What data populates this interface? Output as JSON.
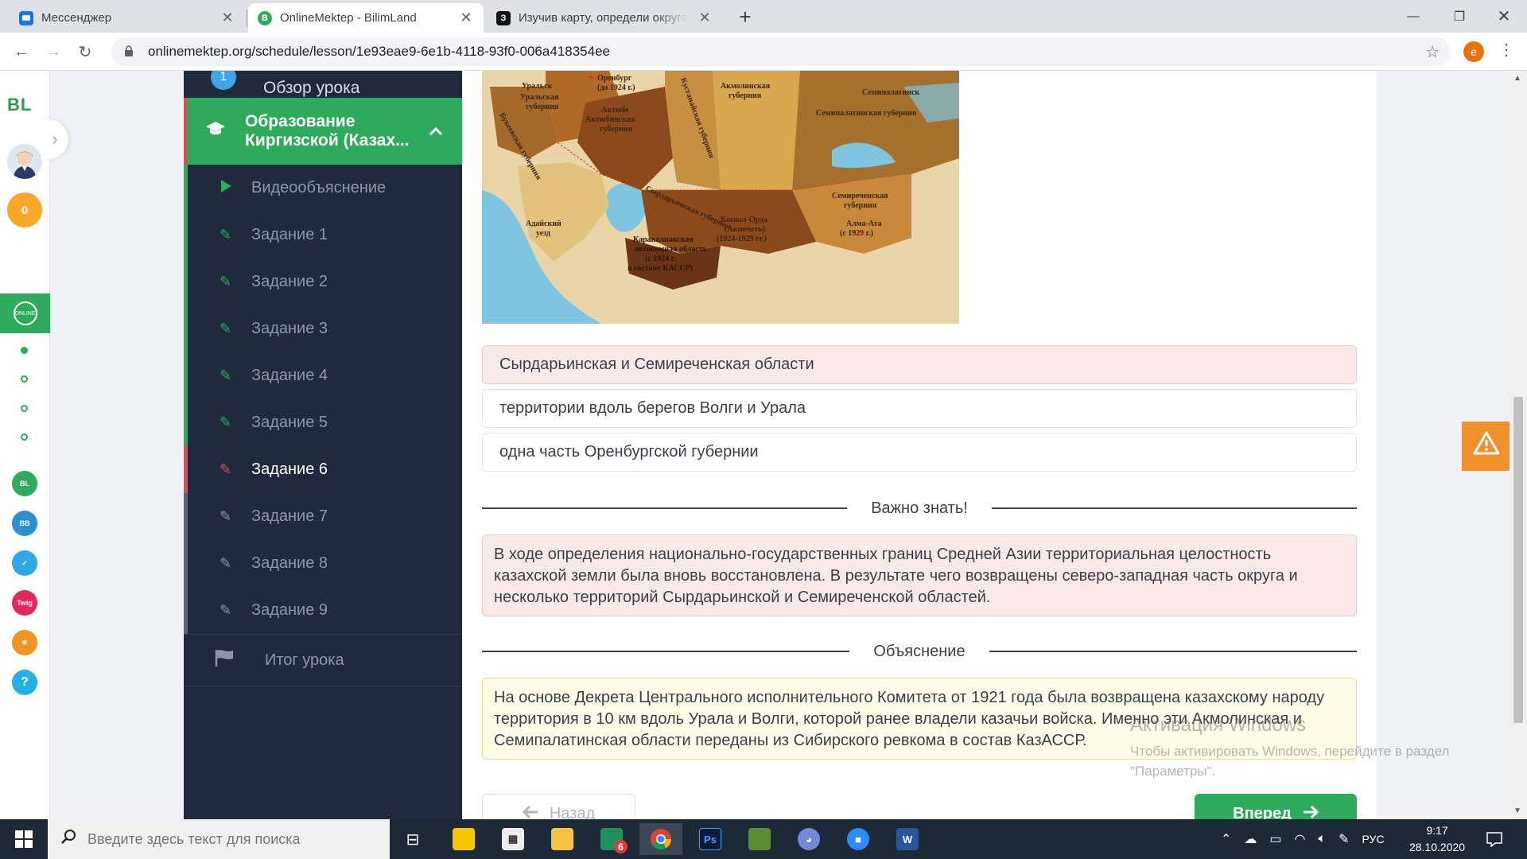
{
  "browser": {
    "tabs": [
      {
        "title": "Мессенджер",
        "favicon": "messenger-icon",
        "color": "#1a73e8"
      },
      {
        "title": "OnlineMektep - BilimLand",
        "favicon": "bilimland-icon",
        "color": "#2eaa5c"
      },
      {
        "title": "Изучив карту, определи округа",
        "favicon": "znanija-icon",
        "color": "#111111"
      }
    ],
    "url": "onlinemektep.org/schedule/lesson/1e93eae9-6e1b-4118-93f0-006a418354ee",
    "profile_initial": "e"
  },
  "rail": {
    "logo": "BL",
    "points": "0",
    "active_app": "online mektep",
    "apps": [
      "bilimland",
      "bilim book",
      "bilim class",
      "twig",
      "bilimland kids",
      "help"
    ]
  },
  "lesson_nav": {
    "overview_number": "1",
    "overview": "Обзор урока",
    "section_title": "Образование Киргизской (Казах...",
    "items": [
      {
        "label": "Видеообъяснение",
        "icon": "play-icon"
      },
      {
        "label": "Задание 1",
        "icon": "edit-icon"
      },
      {
        "label": "Задание 2",
        "icon": "edit-icon"
      },
      {
        "label": "Задание 3",
        "icon": "edit-icon"
      },
      {
        "label": "Задание 4",
        "icon": "edit-icon"
      },
      {
        "label": "Задание 5",
        "icon": "edit-icon"
      },
      {
        "label": "Задание 6",
        "icon": "edit-icon"
      },
      {
        "label": "Задание 7",
        "icon": "edit-icon"
      },
      {
        "label": "Задание 8",
        "icon": "edit-icon"
      },
      {
        "label": "Задание 9",
        "icon": "edit-icon"
      }
    ],
    "summary": "Итог урока"
  },
  "map": {
    "labels": {
      "uralsk": "Уральск",
      "uralsk_gub": "Уральская губерния",
      "bukeev": "Букеевская губерния",
      "orenburg": "Оренбург (до 1924 г.)",
      "aktobe": "Актюбе Актюбинская губерния",
      "kustanai": "Кустанайская губерния",
      "akmola": "Акмолинская губерния",
      "semipalatinsk": "Семипалатинск",
      "semipalatinsk_gub": "Семипалатинская губерния",
      "syrdarya": "Сырдарьинская губерния",
      "semirechye": "Семиреченская губерния",
      "alma_ata": "Алма-Ата (с 1929 г.)",
      "adai": "Адайский уезд",
      "kyzylorda": "Кызыл-Орда (Акмечеть) (1924-1929 гг.)",
      "karakalpak": "Каракалпакская автономная область (с 1924 г. в составе КАССР)"
    }
  },
  "answers": [
    {
      "text": "Сырдарьинская и Семиреченская области",
      "state": "wrong"
    },
    {
      "text": "территории вдоль берегов Волги и Урала",
      "state": "neutral"
    },
    {
      "text": "одна часть Оренбургской губернии",
      "state": "neutral"
    }
  ],
  "important": {
    "heading": "Важно знать!",
    "text": "В ходе определения национально-государственных границ Средней Азии территориальная целостность казахской земли была вновь восстановлена. В результате чего возвращены северо-западная часть округа и несколько территорий Сырдарьинской и Семиреченской областей."
  },
  "explanation": {
    "heading": "Объяснение",
    "text": "На основе Декрета Центрального исполнительного Комитета от 1921 года была возвращена казахскому народу территория в 10 км вдоль Урала и Волги, которой ранее владели казачьи войска. Именно эти Акмолинская и Семипалатинская области переданы из Сибирского ревкома в состав КазАССР."
  },
  "buttons": {
    "back": "Назад",
    "next": "Вперед"
  },
  "watermark": {
    "title": "Активация Windows",
    "subtitle": "Чтобы активировать Windows, перейдите в раздел \"Параметры\"."
  },
  "taskbar": {
    "search_placeholder": "Введите здесь текст для поиска",
    "badge": "6",
    "apps": [
      "task-view",
      "sticky-notes",
      "store",
      "file-explorer",
      "app-badge",
      "chrome",
      "photoshop",
      "minecraft",
      "discord",
      "zoom",
      "word"
    ],
    "lang": "РУС",
    "time": "9:17",
    "date": "28.10.2020"
  },
  "colors": {
    "accent_green": "#2eaa5c",
    "nav_dark": "#1f2b3d",
    "wrong_bg": "#fbe9ea",
    "explanation_bg": "#fffde7",
    "report_orange": "#f0912c"
  }
}
